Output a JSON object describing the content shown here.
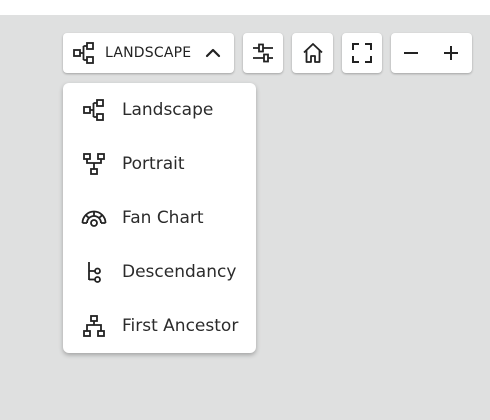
{
  "toolbar": {
    "layout_label": "LANDSCAPE"
  },
  "layout_menu": {
    "items": [
      {
        "label": "Landscape",
        "icon": "landscape-icon"
      },
      {
        "label": "Portrait",
        "icon": "portrait-icon"
      },
      {
        "label": "Fan Chart",
        "icon": "fan-chart-icon"
      },
      {
        "label": "Descendancy",
        "icon": "descendancy-icon"
      },
      {
        "label": "First Ancestor",
        "icon": "first-ancestor-icon"
      }
    ]
  },
  "colors": {
    "canvas": "#dfe0e0",
    "surface": "#ffffff",
    "text": "#222222"
  }
}
